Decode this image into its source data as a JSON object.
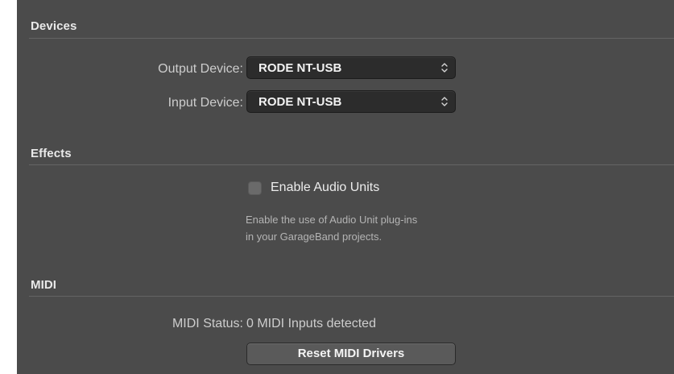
{
  "devices": {
    "title": "Devices",
    "output": {
      "label": "Output Device:",
      "value": "RODE NT-USB",
      "icon": "chevron-up-down-icon"
    },
    "input": {
      "label": "Input Device:",
      "value": "RODE NT-USB",
      "icon": "chevron-up-down-icon"
    }
  },
  "effects": {
    "title": "Effects",
    "checkbox_label": "Enable Audio Units",
    "checked": false,
    "help_line1": "Enable the use of Audio Unit plug-ins",
    "help_line2": "in your GarageBand projects."
  },
  "midi": {
    "title": "MIDI",
    "status_label": "MIDI Status:",
    "status_value": "0 MIDI Inputs detected",
    "reset_button": "Reset MIDI Drivers"
  },
  "colors": {
    "panel_background": "#4b4b4b",
    "popup_background": "#2c2c2c",
    "button_background": "#5a5a5a",
    "text_primary": "#ececec",
    "text_secondary": "#cdcdcd"
  }
}
